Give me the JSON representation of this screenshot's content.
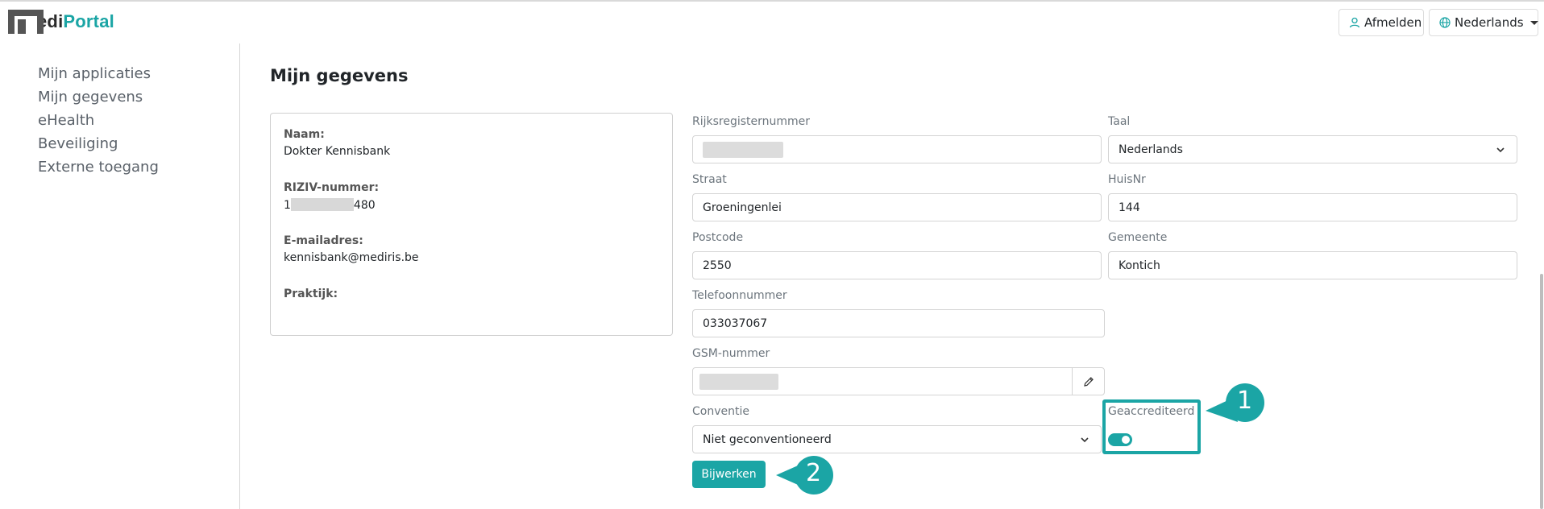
{
  "app": {
    "logo_prefix": "edi",
    "logo_accent": "Portal",
    "accent_color": "#1ba5a5"
  },
  "header": {
    "logout_label": "Afmelden",
    "language_label": "Nederlands"
  },
  "sidebar": {
    "items": [
      {
        "label": "Mijn applicaties"
      },
      {
        "label": "Mijn gegevens"
      },
      {
        "label": "eHealth"
      },
      {
        "label": "Beveiliging"
      },
      {
        "label": "Externe toegang"
      }
    ]
  },
  "main": {
    "title": "Mijn gegevens",
    "card": {
      "name_label": "Naam:",
      "name_value": "Dokter Kennisbank",
      "riziv_label": "RIZIV-nummer:",
      "riziv_prefix": "1",
      "riziv_suffix": "480",
      "email_label": "E-mailadres:",
      "email_value": "kennisbank@mediris.be",
      "practice_label": "Praktijk:"
    },
    "form": {
      "rijksregister_label": "Rijksregisternummer",
      "taal_label": "Taal",
      "taal_value": "Nederlands",
      "straat_label": "Straat",
      "straat_value": "Groeningenlei",
      "huisnr_label": "HuisNr",
      "huisnr_value": "144",
      "postcode_label": "Postcode",
      "postcode_value": "2550",
      "gemeente_label": "Gemeente",
      "gemeente_value": "Kontich",
      "telefoon_label": "Telefoonnummer",
      "telefoon_value": "033037067",
      "gsm_label": "GSM-nummer",
      "conventie_label": "Conventie",
      "conventie_value": "Niet geconventioneerd",
      "geaccrediteerd_label": "Geaccrediteerd",
      "geaccrediteerd_on": true,
      "update_label": "Bijwerken"
    },
    "callouts": [
      {
        "number": "1"
      },
      {
        "number": "2"
      }
    ]
  }
}
